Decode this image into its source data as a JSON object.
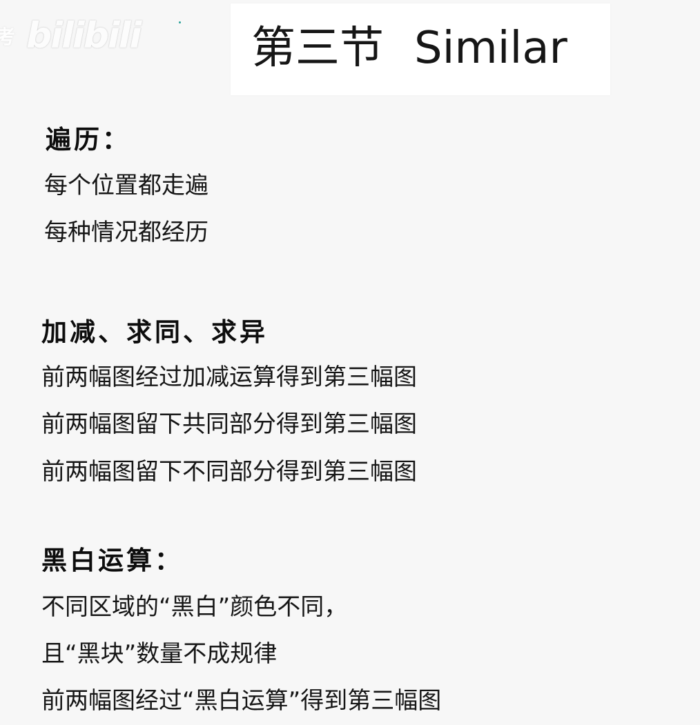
{
  "watermark": {
    "prefix": "考",
    "logo": "bilibili"
  },
  "title": {
    "chapter": "第三节",
    "name": "Similar"
  },
  "sections": [
    {
      "heading": "遍历：",
      "lines": [
        "每个位置都走遍",
        "每种情况都经历"
      ]
    },
    {
      "heading": "加减、求同、求异",
      "lines": [
        "前两幅图经过加减运算得到第三幅图",
        "前两幅图留下共同部分得到第三幅图",
        "前两幅图留下不同部分得到第三幅图"
      ]
    },
    {
      "heading": "黑白运算：",
      "lines": [
        "不同区域的“黑白”颜色不同，",
        "且“黑块”数量不成规律",
        "前两幅图经过“黑白运算”得到第三幅图"
      ]
    }
  ]
}
